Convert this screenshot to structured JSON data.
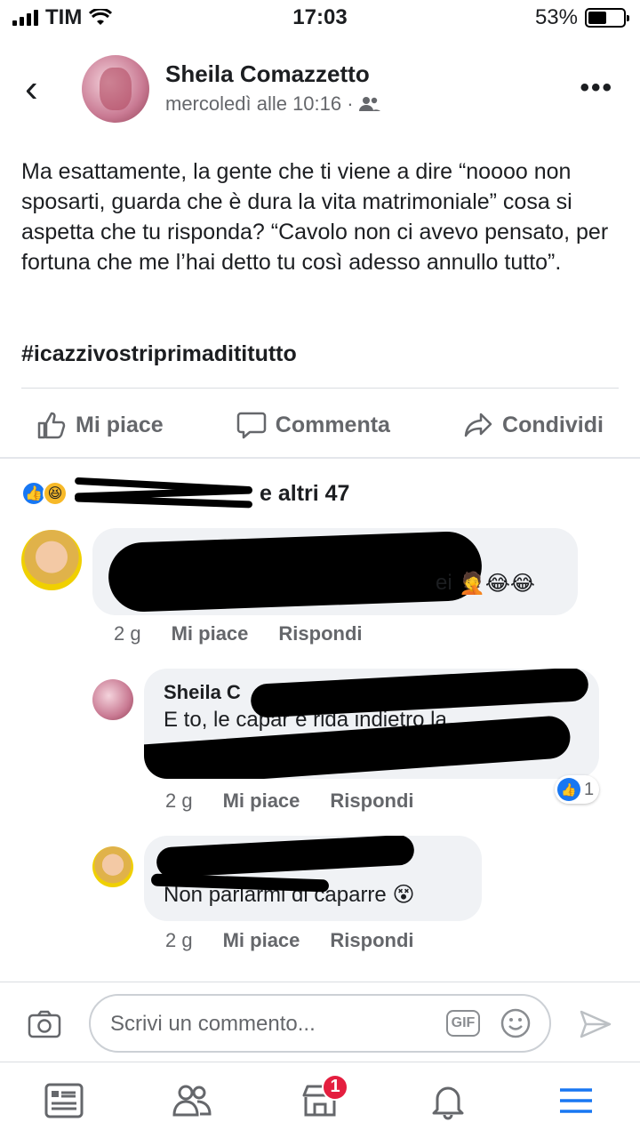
{
  "status_bar": {
    "carrier": "TIM",
    "time": "17:03",
    "battery": "53%",
    "battery_level": 0.53
  },
  "post": {
    "author": "Sheila Comazzetto",
    "timestamp": "mercoledì alle 10:16 ·",
    "audience_icon": "friends-icon",
    "text": "Ma esattamente, la gente che ti viene a dire “noooo non sposarti, guarda che è dura la vita matrimoniale” cosa si aspetta che tu risponda? “Cavolo non ci avevo pensato, per fortuna che me l’hai detto tu così adesso annullo tutto”.",
    "hashtag": "#icazzivostriprimadititutto"
  },
  "actions": {
    "like": "Mi piace",
    "comment": "Commenta",
    "share": "Condividi"
  },
  "reactions": {
    "summary": "e altri 47"
  },
  "comments": [
    {
      "text_visible": "ei",
      "emoji": "🤦😂😂",
      "age": "2 g",
      "like": "Mi piace",
      "reply": "Rispondi"
    },
    {
      "name_visible": "Sheila C",
      "text_visible": "E  to, le capar        e ridà indietro la",
      "age": "2 g",
      "like": "Mi piace",
      "reply": "Rispondi",
      "likes": "1"
    },
    {
      "text_visible": "Non parlarmi di caparre 😵",
      "age": "2 g",
      "like": "Mi piace",
      "reply": "Rispondi"
    }
  ],
  "composer": {
    "placeholder": "Scrivi un commento...",
    "gif": "GIF"
  },
  "tabbar": {
    "notifications_badge": "1"
  },
  "colors": {
    "brand_blue": "#1877f2",
    "badge_red": "#e41e3f",
    "secondary_text": "#65676b"
  }
}
